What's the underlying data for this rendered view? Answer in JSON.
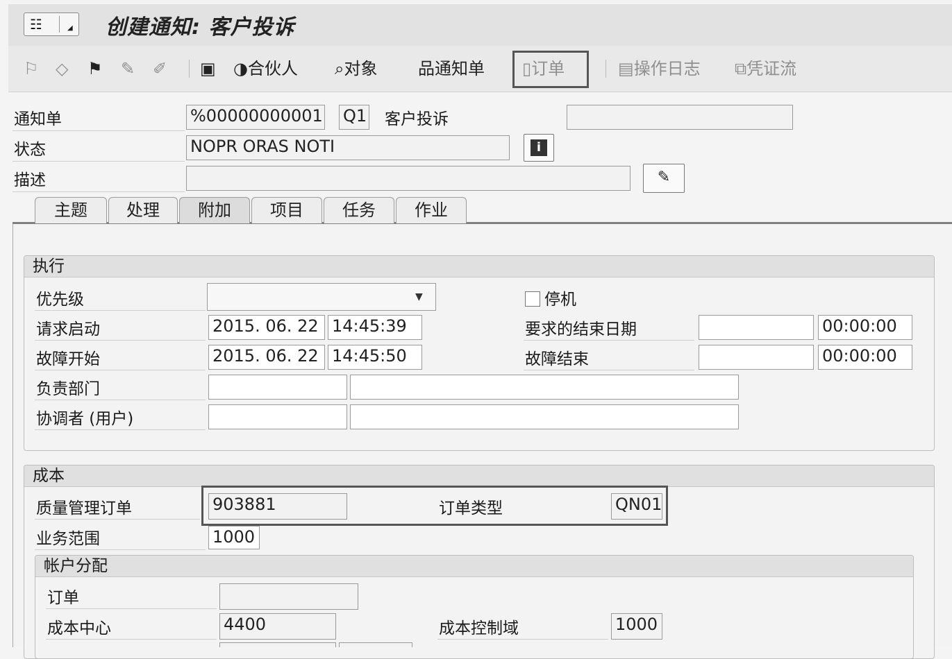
{
  "window": {
    "title": "创建通知: 客户投诉"
  },
  "toolbar": {
    "partner": "合伙人",
    "object": "对象",
    "notification": "通知单",
    "order": "订单",
    "action_log": "操作日志",
    "doc_flow": "凭证流"
  },
  "header": {
    "notification_label": "通知单",
    "notification_value": "%00000000001",
    "type_value": "Q1",
    "type_text": "客户投诉",
    "status_label": "状态",
    "status_value": "NOPR ORAS NOTI",
    "description_label": "描述",
    "description_value": ""
  },
  "tabs": [
    {
      "label": "主题",
      "active": false
    },
    {
      "label": "处理",
      "active": false
    },
    {
      "label": "附加",
      "active": true
    },
    {
      "label": "项目",
      "active": false
    },
    {
      "label": "任务",
      "active": false
    },
    {
      "label": "作业",
      "active": false
    }
  ],
  "execution": {
    "title": "执行",
    "priority_label": "优先级",
    "priority_value": "",
    "breakdown_label": "停机",
    "breakdown_checked": false,
    "req_start_label": "请求启动",
    "req_start_date": "2015. 06. 22",
    "req_start_time": "14:45:39",
    "req_end_label": "要求的结束日期",
    "req_end_date": "",
    "req_end_time": "00:00:00",
    "malf_start_label": "故障开始",
    "malf_start_date": "2015. 06. 22",
    "malf_start_time": "14:45:50",
    "malf_end_label": "故障结束",
    "malf_end_date": "",
    "malf_end_time": "00:00:00",
    "resp_dept_label": "负责部门",
    "coordinator_label": "协调者 (用户)"
  },
  "costs": {
    "title": "成本",
    "qm_order_label": "质量管理订单",
    "qm_order_value": "903881",
    "order_type_label": "订单类型",
    "order_type_value": "QN01",
    "business_area_label": "业务范围",
    "business_area_value": "1000",
    "account_assignment": {
      "title": "帐户分配",
      "order_label": "订单",
      "order_value": "",
      "cost_center_label": "成本中心",
      "cost_center_value": "4400",
      "co_area_label": "成本控制域",
      "co_area_value": "1000"
    }
  },
  "icons": [
    "menu-icon",
    "flag-icon",
    "eraser-icon",
    "checkered-flag-icon",
    "pencil-icon",
    "edit-icon",
    "screen-icon",
    "partner-icon",
    "object-icon",
    "hierarchy-icon",
    "document-icon",
    "action-log-icon",
    "document-flow-icon",
    "info-icon",
    "long-text-edit-icon",
    "dropdown-caret-icon"
  ]
}
